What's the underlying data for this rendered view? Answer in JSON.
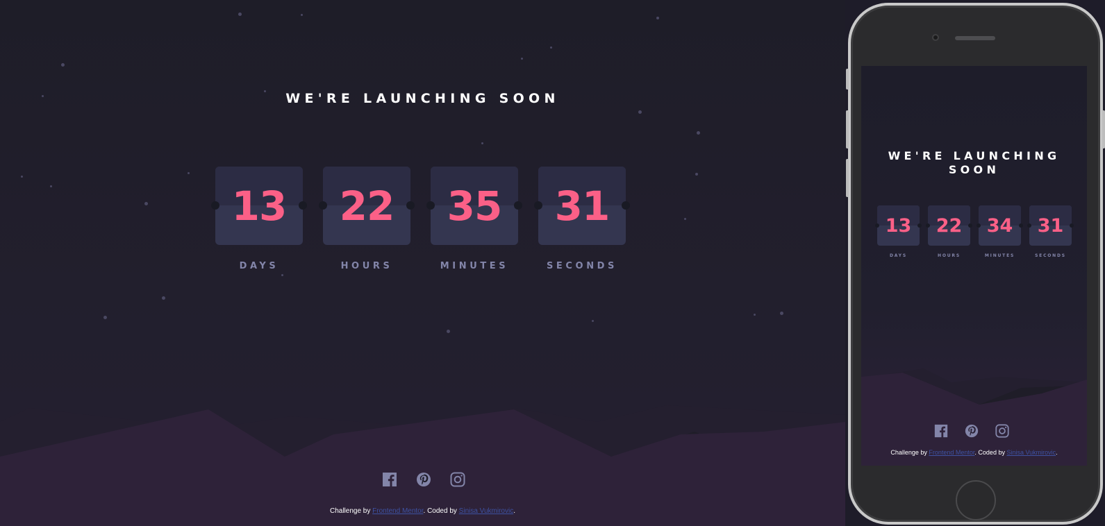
{
  "desktop": {
    "title": "WE'RE LAUNCHING SOON",
    "countdown": [
      {
        "value": "13",
        "label": "DAYS"
      },
      {
        "value": "22",
        "label": "HOURS"
      },
      {
        "value": "35",
        "label": "MINUTES"
      },
      {
        "value": "31",
        "label": "SECONDS"
      }
    ],
    "social": [
      "facebook-icon",
      "pinterest-icon",
      "instagram-icon"
    ],
    "credit": {
      "prefix": "Challenge by ",
      "link1": "Frontend Mentor",
      "middle": ". Coded by ",
      "link2": "Sinisa Vukmirovic",
      "suffix": "."
    }
  },
  "mobile": {
    "title": "WE'RE LAUNCHING SOON",
    "countdown": [
      {
        "value": "13",
        "label": "DAYS"
      },
      {
        "value": "22",
        "label": "HOURS"
      },
      {
        "value": "34",
        "label": "MINUTES"
      },
      {
        "value": "31",
        "label": "SECONDS"
      }
    ],
    "credit": {
      "prefix": "Challenge by ",
      "link1": "Frontend Mentor",
      "middle": ". Coded by ",
      "link2": "Sinisa Vukmirovic",
      "suffix": "."
    }
  },
  "colors": {
    "accent": "#fb6087",
    "label": "#8385a9",
    "card_top": "#2c2c44",
    "card_bottom": "#343650",
    "background": "#1e1c29",
    "link": "#3e52a3"
  }
}
